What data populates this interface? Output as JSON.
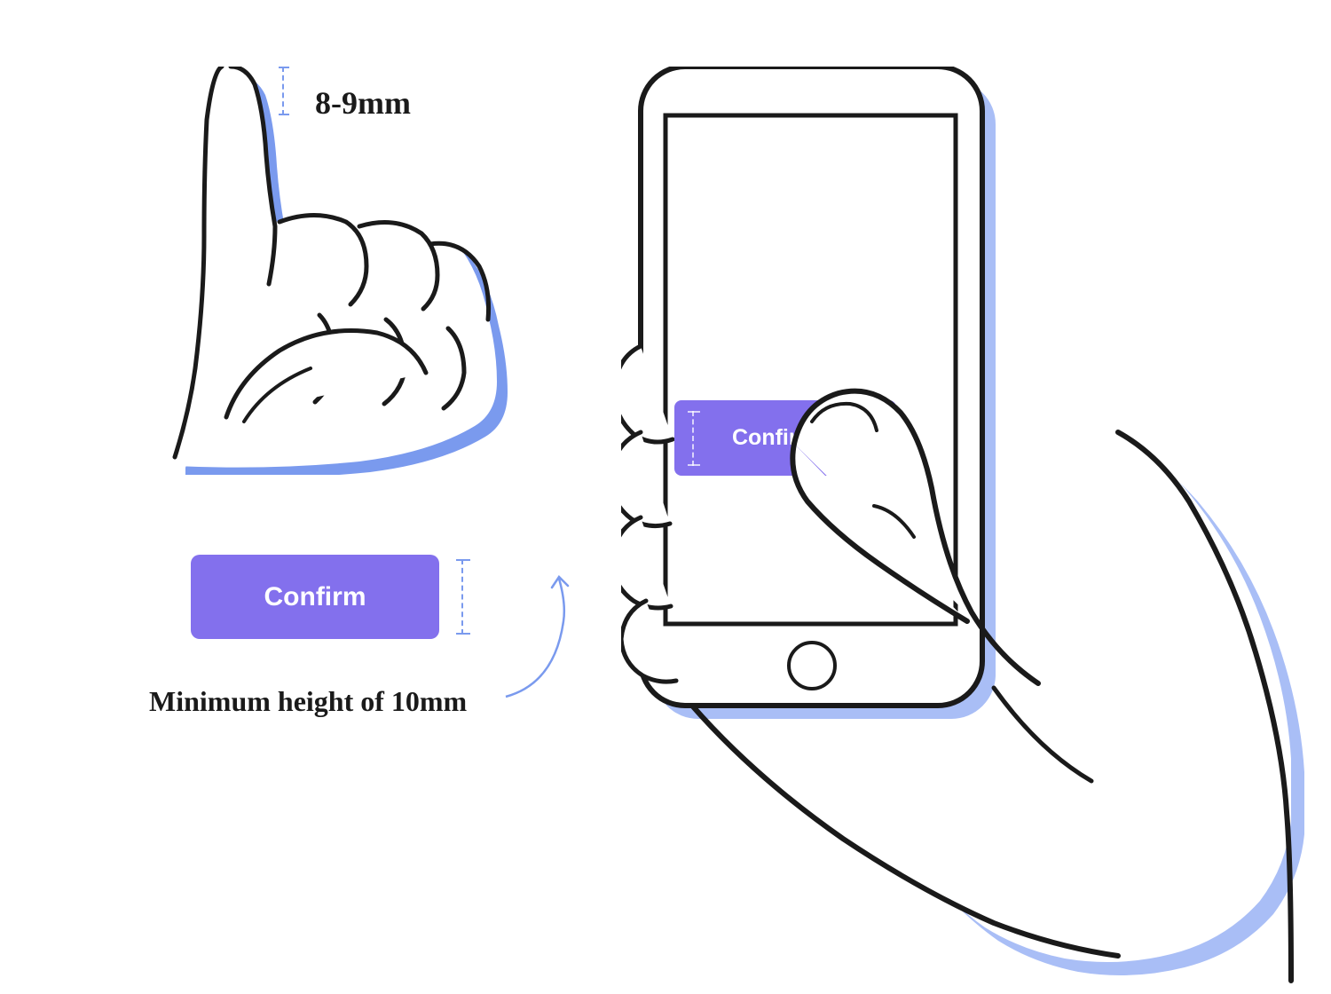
{
  "labels": {
    "finger_width": "8-9mm",
    "button_text": "Confirm",
    "min_height": "Minimum height of 10mm",
    "phone_button_text": "Confirm"
  },
  "colors": {
    "button_bg": "#8370ED",
    "highlight_blue": "#7a9aee",
    "measure_blue": "#7a9aee",
    "text_dark": "#1a1a1a",
    "white": "#ffffff"
  },
  "diagram": {
    "type": "touch-target-sizing-guidelines",
    "finger_width_mm": "8-9",
    "min_button_height_mm": 10
  }
}
